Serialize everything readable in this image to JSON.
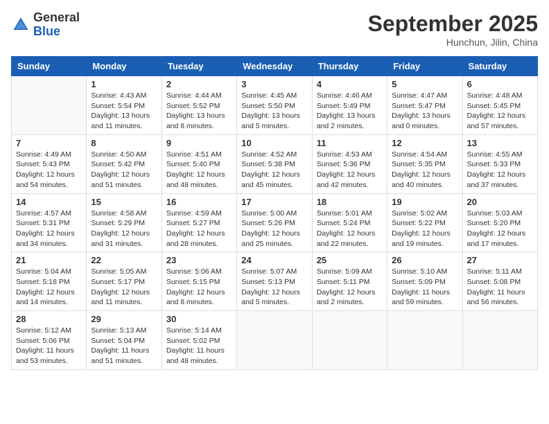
{
  "header": {
    "logo_general": "General",
    "logo_blue": "Blue",
    "month_title": "September 2025",
    "location": "Hunchun, Jilin, China"
  },
  "days_of_week": [
    "Sunday",
    "Monday",
    "Tuesday",
    "Wednesday",
    "Thursday",
    "Friday",
    "Saturday"
  ],
  "weeks": [
    [
      {
        "day": "",
        "sunrise": "",
        "sunset": "",
        "daylight": ""
      },
      {
        "day": "1",
        "sunrise": "Sunrise: 4:43 AM",
        "sunset": "Sunset: 5:54 PM",
        "daylight": "Daylight: 13 hours and 11 minutes."
      },
      {
        "day": "2",
        "sunrise": "Sunrise: 4:44 AM",
        "sunset": "Sunset: 5:52 PM",
        "daylight": "Daylight: 13 hours and 8 minutes."
      },
      {
        "day": "3",
        "sunrise": "Sunrise: 4:45 AM",
        "sunset": "Sunset: 5:50 PM",
        "daylight": "Daylight: 13 hours and 5 minutes."
      },
      {
        "day": "4",
        "sunrise": "Sunrise: 4:46 AM",
        "sunset": "Sunset: 5:49 PM",
        "daylight": "Daylight: 13 hours and 2 minutes."
      },
      {
        "day": "5",
        "sunrise": "Sunrise: 4:47 AM",
        "sunset": "Sunset: 5:47 PM",
        "daylight": "Daylight: 13 hours and 0 minutes."
      },
      {
        "day": "6",
        "sunrise": "Sunrise: 4:48 AM",
        "sunset": "Sunset: 5:45 PM",
        "daylight": "Daylight: 12 hours and 57 minutes."
      }
    ],
    [
      {
        "day": "7",
        "sunrise": "Sunrise: 4:49 AM",
        "sunset": "Sunset: 5:43 PM",
        "daylight": "Daylight: 12 hours and 54 minutes."
      },
      {
        "day": "8",
        "sunrise": "Sunrise: 4:50 AM",
        "sunset": "Sunset: 5:42 PM",
        "daylight": "Daylight: 12 hours and 51 minutes."
      },
      {
        "day": "9",
        "sunrise": "Sunrise: 4:51 AM",
        "sunset": "Sunset: 5:40 PM",
        "daylight": "Daylight: 12 hours and 48 minutes."
      },
      {
        "day": "10",
        "sunrise": "Sunrise: 4:52 AM",
        "sunset": "Sunset: 5:38 PM",
        "daylight": "Daylight: 12 hours and 45 minutes."
      },
      {
        "day": "11",
        "sunrise": "Sunrise: 4:53 AM",
        "sunset": "Sunset: 5:36 PM",
        "daylight": "Daylight: 12 hours and 42 minutes."
      },
      {
        "day": "12",
        "sunrise": "Sunrise: 4:54 AM",
        "sunset": "Sunset: 5:35 PM",
        "daylight": "Daylight: 12 hours and 40 minutes."
      },
      {
        "day": "13",
        "sunrise": "Sunrise: 4:55 AM",
        "sunset": "Sunset: 5:33 PM",
        "daylight": "Daylight: 12 hours and 37 minutes."
      }
    ],
    [
      {
        "day": "14",
        "sunrise": "Sunrise: 4:57 AM",
        "sunset": "Sunset: 5:31 PM",
        "daylight": "Daylight: 12 hours and 34 minutes."
      },
      {
        "day": "15",
        "sunrise": "Sunrise: 4:58 AM",
        "sunset": "Sunset: 5:29 PM",
        "daylight": "Daylight: 12 hours and 31 minutes."
      },
      {
        "day": "16",
        "sunrise": "Sunrise: 4:59 AM",
        "sunset": "Sunset: 5:27 PM",
        "daylight": "Daylight: 12 hours and 28 minutes."
      },
      {
        "day": "17",
        "sunrise": "Sunrise: 5:00 AM",
        "sunset": "Sunset: 5:26 PM",
        "daylight": "Daylight: 12 hours and 25 minutes."
      },
      {
        "day": "18",
        "sunrise": "Sunrise: 5:01 AM",
        "sunset": "Sunset: 5:24 PM",
        "daylight": "Daylight: 12 hours and 22 minutes."
      },
      {
        "day": "19",
        "sunrise": "Sunrise: 5:02 AM",
        "sunset": "Sunset: 5:22 PM",
        "daylight": "Daylight: 12 hours and 19 minutes."
      },
      {
        "day": "20",
        "sunrise": "Sunrise: 5:03 AM",
        "sunset": "Sunset: 5:20 PM",
        "daylight": "Daylight: 12 hours and 17 minutes."
      }
    ],
    [
      {
        "day": "21",
        "sunrise": "Sunrise: 5:04 AM",
        "sunset": "Sunset: 5:18 PM",
        "daylight": "Daylight: 12 hours and 14 minutes."
      },
      {
        "day": "22",
        "sunrise": "Sunrise: 5:05 AM",
        "sunset": "Sunset: 5:17 PM",
        "daylight": "Daylight: 12 hours and 11 minutes."
      },
      {
        "day": "23",
        "sunrise": "Sunrise: 5:06 AM",
        "sunset": "Sunset: 5:15 PM",
        "daylight": "Daylight: 12 hours and 8 minutes."
      },
      {
        "day": "24",
        "sunrise": "Sunrise: 5:07 AM",
        "sunset": "Sunset: 5:13 PM",
        "daylight": "Daylight: 12 hours and 5 minutes."
      },
      {
        "day": "25",
        "sunrise": "Sunrise: 5:09 AM",
        "sunset": "Sunset: 5:11 PM",
        "daylight": "Daylight: 12 hours and 2 minutes."
      },
      {
        "day": "26",
        "sunrise": "Sunrise: 5:10 AM",
        "sunset": "Sunset: 5:09 PM",
        "daylight": "Daylight: 11 hours and 59 minutes."
      },
      {
        "day": "27",
        "sunrise": "Sunrise: 5:11 AM",
        "sunset": "Sunset: 5:08 PM",
        "daylight": "Daylight: 11 hours and 56 minutes."
      }
    ],
    [
      {
        "day": "28",
        "sunrise": "Sunrise: 5:12 AM",
        "sunset": "Sunset: 5:06 PM",
        "daylight": "Daylight: 11 hours and 53 minutes."
      },
      {
        "day": "29",
        "sunrise": "Sunrise: 5:13 AM",
        "sunset": "Sunset: 5:04 PM",
        "daylight": "Daylight: 11 hours and 51 minutes."
      },
      {
        "day": "30",
        "sunrise": "Sunrise: 5:14 AM",
        "sunset": "Sunset: 5:02 PM",
        "daylight": "Daylight: 11 hours and 48 minutes."
      },
      {
        "day": "",
        "sunrise": "",
        "sunset": "",
        "daylight": ""
      },
      {
        "day": "",
        "sunrise": "",
        "sunset": "",
        "daylight": ""
      },
      {
        "day": "",
        "sunrise": "",
        "sunset": "",
        "daylight": ""
      },
      {
        "day": "",
        "sunrise": "",
        "sunset": "",
        "daylight": ""
      }
    ]
  ]
}
